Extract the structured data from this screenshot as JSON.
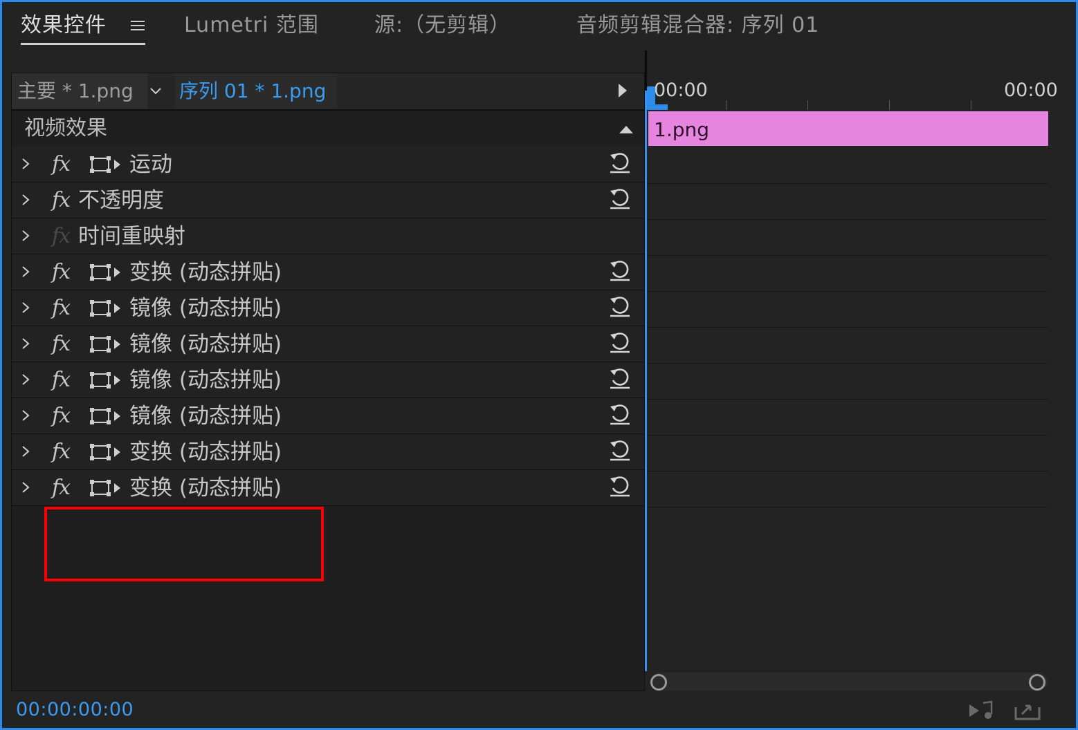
{
  "tabs": [
    {
      "label": "效果控件"
    },
    {
      "label": "Lumetri 范围"
    },
    {
      "label": "源:（无剪辑）"
    },
    {
      "label": "音频剪辑混合器: 序列 01"
    }
  ],
  "clip_selector": {
    "master_label": "主要 * 1.png",
    "sequence_label": "序列 01 * 1.png"
  },
  "section": {
    "title": "视频效果"
  },
  "effects": [
    {
      "name": "运动"
    },
    {
      "name": "不透明度"
    },
    {
      "name": "时间重映射"
    },
    {
      "name": "变换 (动态拼贴)"
    },
    {
      "name": "镜像 (动态拼贴)"
    },
    {
      "name": "镜像 (动态拼贴)"
    },
    {
      "name": "镜像 (动态拼贴)"
    },
    {
      "name": "镜像 (动态拼贴)"
    },
    {
      "name": "变换 (动态拼贴)"
    },
    {
      "name": "变换 (动态拼贴)"
    }
  ],
  "fx_label": "fx",
  "timeline": {
    "start_time": "00:00",
    "end_time": "00:00",
    "clip_name": "1.png"
  },
  "current_timecode": "00:00:00:00",
  "colors": {
    "accent": "#2d8ceb",
    "clip": "#e585e0",
    "highlight": "#ff0000"
  }
}
